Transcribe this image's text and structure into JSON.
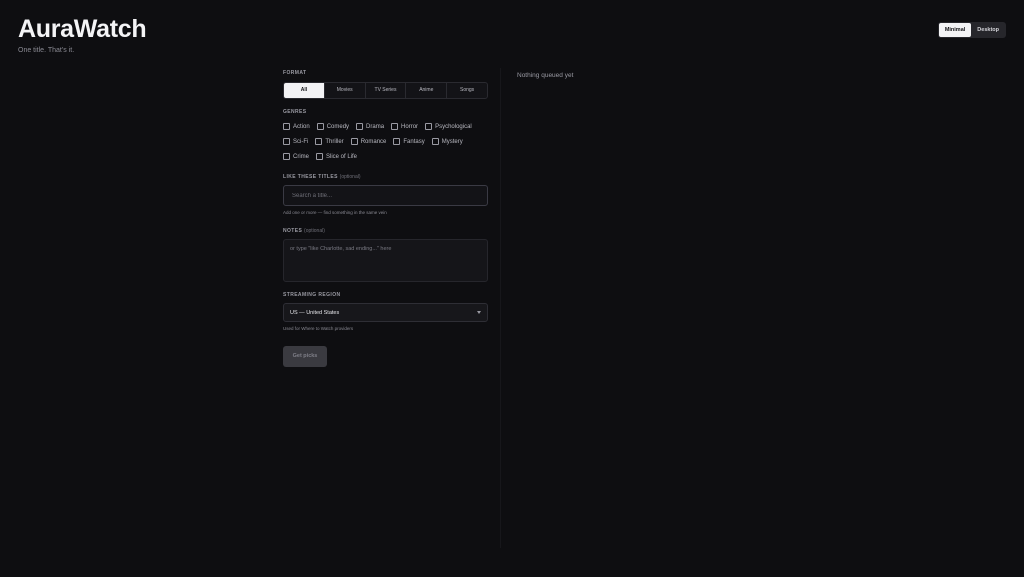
{
  "brand": {
    "title": "AuraWatch",
    "tagline": "One title. That’s it."
  },
  "view_toggle": {
    "options": [
      "Minimal",
      "Desktop"
    ],
    "active": "Minimal"
  },
  "format": {
    "label": "FORMAT",
    "options": [
      "All",
      "Movies",
      "TV Series",
      "Anime",
      "Songs"
    ],
    "active": "All"
  },
  "genres": {
    "label": "GENRES",
    "items": [
      "Action",
      "Comedy",
      "Drama",
      "Horror",
      "Psychological",
      "Sci-Fi",
      "Thriller",
      "Romance",
      "Fantasy",
      "Mystery",
      "Crime",
      "Slice of Life"
    ]
  },
  "like_titles": {
    "label": "LIKE THESE TITLES",
    "optional": "(optional)",
    "placeholder": "Search a title...",
    "value": "",
    "hint": "Add one or more — find something in the same vein"
  },
  "notes": {
    "label": "NOTES",
    "optional": "(optional)",
    "placeholder": "or type \"like Charlotte, sad ending...\" here",
    "value": ""
  },
  "region": {
    "label": "STREAMING REGION",
    "value": "US — United States",
    "hint": "Used for Where to Watch providers"
  },
  "submit": {
    "label": "Get picks"
  },
  "queue": {
    "empty_text": "Nothing queued yet"
  }
}
